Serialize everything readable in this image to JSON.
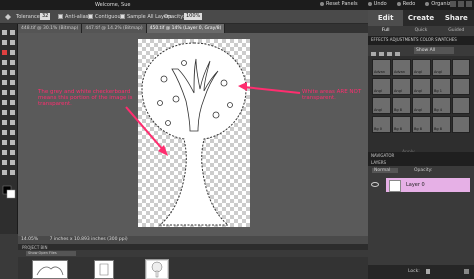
{
  "menubar": {
    "welcome": "Welcome, Sue",
    "reset_panels": "Reset Panels",
    "undo": "Undo",
    "redo": "Redo",
    "organizer": "Organizer"
  },
  "options": {
    "tolerance_label": "Tolerance:",
    "tolerance_value": "32",
    "anti_alias": "Anti-alias",
    "contiguous": "Contiguous",
    "sample_all_layers": "Sample All Layers",
    "opacity_label": "Opacity:",
    "opacity_value": "100%"
  },
  "tabs": [
    {
      "label": "448.tif @ 30.1% (Bitmap)"
    },
    {
      "label": "447.tif @ 14.2% (Bitmap)"
    },
    {
      "label": "450.tif @ 14% (Layer 0, Gray/8)"
    }
  ],
  "annotations": {
    "left": "The grey and white checkerboard means this portion of the image is transparent.",
    "right": "White areas ARE NOT transparent."
  },
  "status": {
    "zoom": "14.05%",
    "doc_size": "7 inches x 10.893 inches (300 ppi)"
  },
  "project_bin": {
    "title": "PROJECT BIN",
    "show": "Show Open Files"
  },
  "right_panel": {
    "modes": [
      "Edit",
      "Create",
      "Share"
    ],
    "submodes": [
      "Full",
      "Quick",
      "Guided"
    ],
    "effects_tabs": "EFFECTS   ADJUSTMENTS   COLOR SWATCHES",
    "effects_filter": "Show All",
    "apply": "Apply",
    "navigator": "NAVIGATOR",
    "layers": "LAYERS",
    "blend_mode": "Normal",
    "layer_opacity": "Opacity:",
    "layer_name": "Layer 0",
    "lock": "Lock:",
    "effect_labels": [
      "Advan",
      "Advan",
      "Angl",
      "Angl",
      "",
      "Angl",
      "Angl",
      "Angl",
      "Bg 1",
      "",
      "Angl",
      "Bg 8",
      "Angl",
      "Bg 4",
      "",
      "Bg 0",
      "Bg 8",
      "Bg 8",
      "Bg 8",
      ""
    ]
  }
}
